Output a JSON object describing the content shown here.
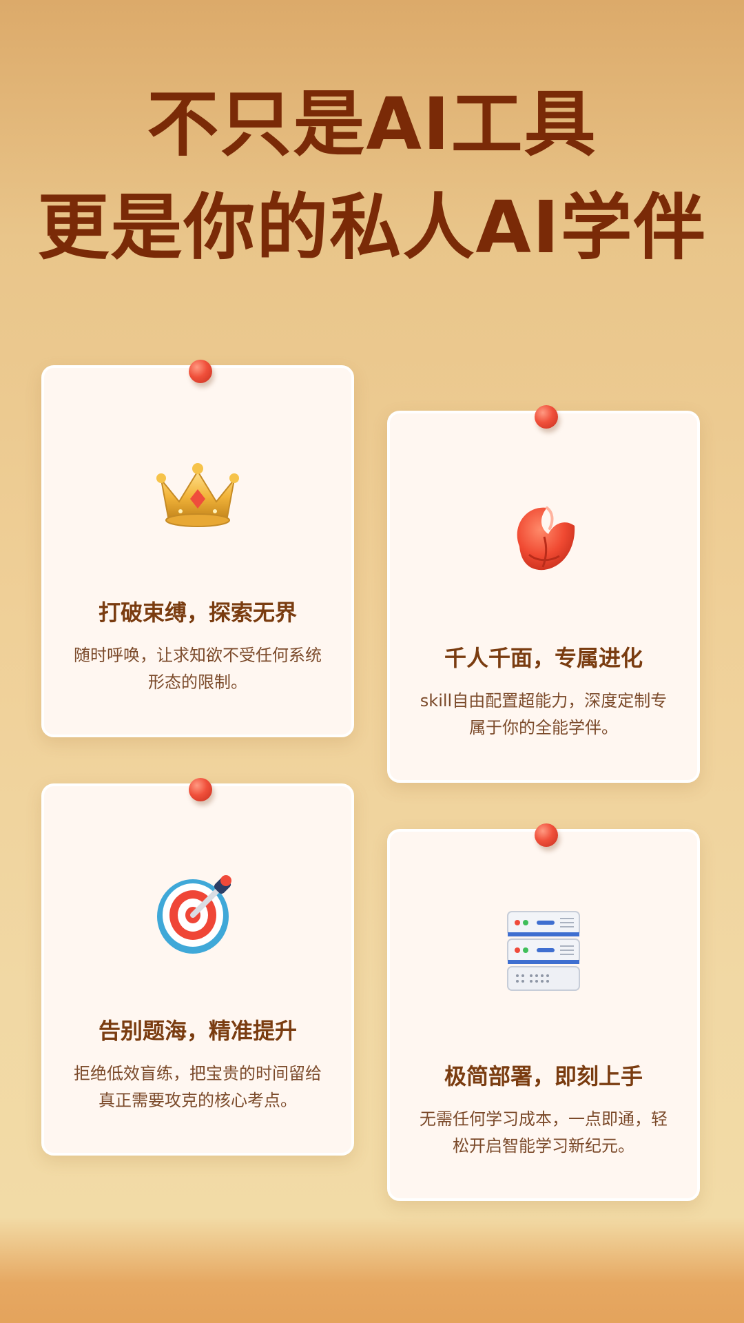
{
  "hero": {
    "line1": "不只是AI工具",
    "line2": "更是你的私人AI学伴"
  },
  "cards": [
    {
      "icon": "crown-icon",
      "title": "打破束缚，探索无界",
      "desc": "随时呼唤，让求知欲不受任何系统形态的限制。"
    },
    {
      "icon": "lobster-claw-icon",
      "title": "千人千面，专属进化",
      "desc": "skill自由配置超能力，深度定制专属于你的全能学伴。"
    },
    {
      "icon": "target-dart-icon",
      "title": "告别题海，精准提升",
      "desc": "拒绝低效盲练，把宝贵的时间留给真正需要攻克的核心考点。"
    },
    {
      "icon": "server-stack-icon",
      "title": "极简部署，即刻上手",
      "desc": "无需任何学习成本，一点即通，轻松开启智能学习新纪元。"
    }
  ],
  "colors": {
    "title": "#7a2a07",
    "card_title": "#7a3c10",
    "card_text": "#7b4a2a",
    "pin": "#e8483a"
  }
}
